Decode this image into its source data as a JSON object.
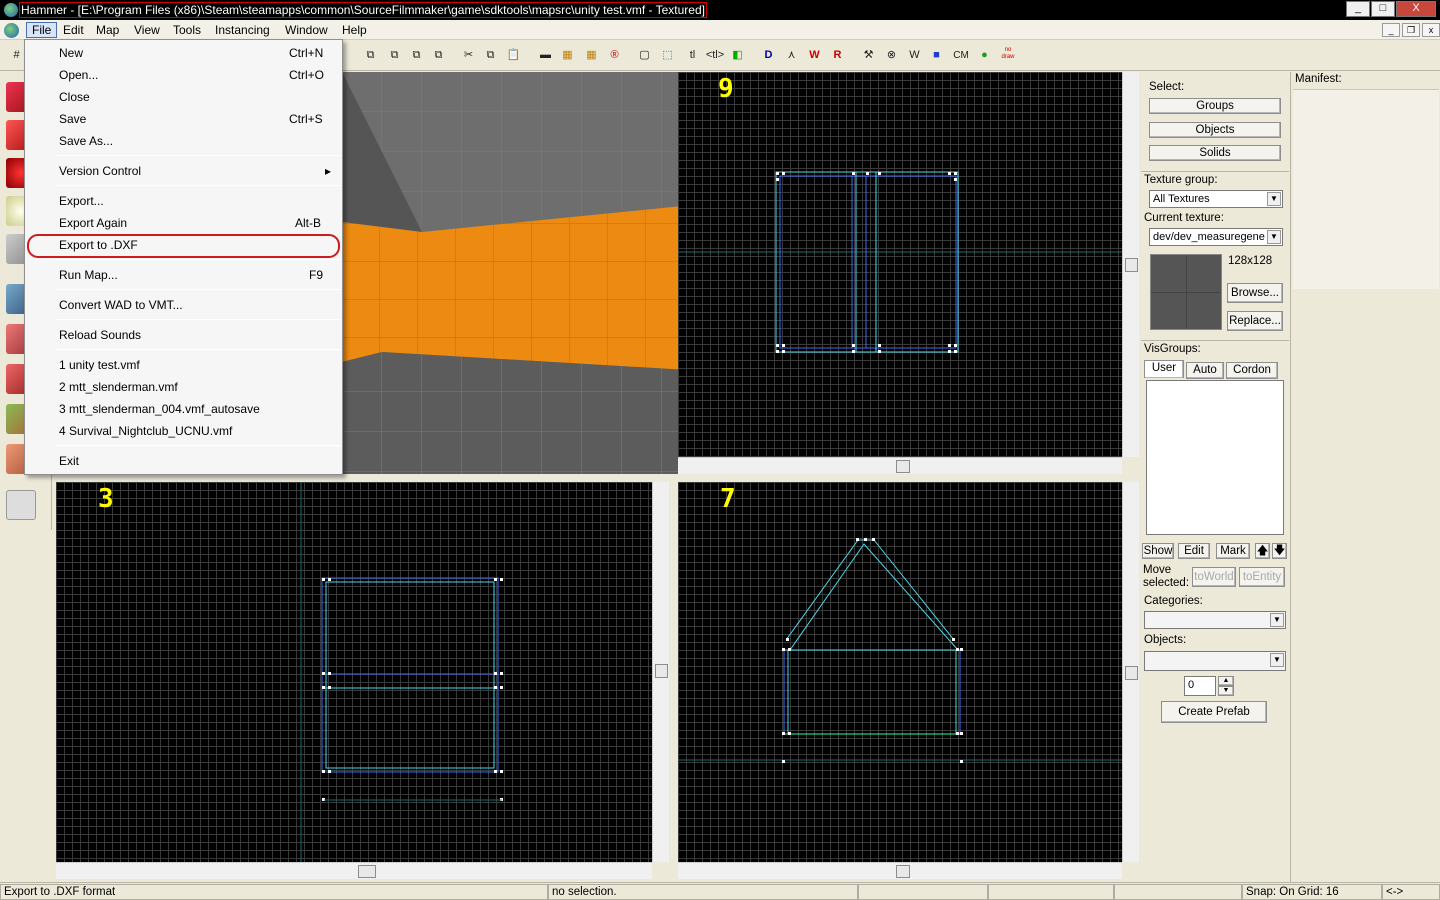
{
  "window": {
    "title": "Hammer - [E:\\Program Files (x86)\\Steam\\steamapps\\common\\SourceFilmmaker\\game\\sdktools\\mapsrc\\unity test.vmf - Textured]",
    "buttons": {
      "minimize": "_",
      "maximize": "□",
      "close": "X"
    },
    "mdi_buttons": {
      "minimize": "_",
      "restore": "❐",
      "close": "x"
    }
  },
  "menubar": [
    "File",
    "Edit",
    "Map",
    "View",
    "Tools",
    "Instancing",
    "Window",
    "Help"
  ],
  "file_menu": {
    "items": [
      {
        "label": "New",
        "shortcut": "Ctrl+N"
      },
      {
        "label": "Open...",
        "shortcut": "Ctrl+O"
      },
      {
        "label": "Close",
        "shortcut": ""
      },
      {
        "label": "Save",
        "shortcut": "Ctrl+S"
      },
      {
        "label": "Save As...",
        "shortcut": ""
      },
      {
        "label": "Version Control",
        "shortcut": "▸"
      },
      {
        "label": "Export...",
        "shortcut": ""
      },
      {
        "label": "Export Again",
        "shortcut": "Alt-B"
      },
      {
        "label": "Export to .DXF",
        "shortcut": ""
      },
      {
        "label": "Run Map...",
        "shortcut": "F9"
      },
      {
        "label": "Convert WAD to VMT...",
        "shortcut": ""
      },
      {
        "label": "Reload Sounds",
        "shortcut": ""
      },
      {
        "label": "1 unity test.vmf",
        "shortcut": ""
      },
      {
        "label": "2 mtt_slenderman.vmf",
        "shortcut": ""
      },
      {
        "label": "3 mtt_slenderman_004.vmf_autosave",
        "shortcut": ""
      },
      {
        "label": "4 Survival_Nightclub_UCNU.vmf",
        "shortcut": ""
      },
      {
        "label": "Exit",
        "shortcut": ""
      }
    ]
  },
  "toolbar": {
    "buttons": [
      "✂",
      "⧉",
      "📋",
      "▬",
      "▦",
      "▦",
      "®",
      "▢",
      "⬚",
      "tl",
      "<tl>",
      "◧",
      "D",
      "⋏",
      "W",
      "R",
      "⚒",
      "⊗",
      "W",
      "■",
      "CM",
      "●",
      "no draw"
    ]
  },
  "viewports": {
    "top_right_label": "9",
    "bottom_left_label": "3",
    "bottom_right_label": "7"
  },
  "right_panel": {
    "select_label": "Select:",
    "groups": "Groups",
    "objects": "Objects",
    "solids": "Solids",
    "texture_group_label": "Texture group:",
    "texture_group_value": "All Textures",
    "current_texture_label": "Current texture:",
    "current_texture_value": "dev/dev_measuregene",
    "texture_size": "128x128",
    "browse": "Browse...",
    "replace": "Replace...",
    "visgroups_label": "VisGroups:",
    "tab_user": "User",
    "tab_auto": "Auto",
    "tab_cordon": "Cordon",
    "show": "Show",
    "edit": "Edit",
    "mark": "Mark",
    "up": "🡅",
    "down": "🡇",
    "move_selected_label": "Move selected:",
    "to_world": "toWorld",
    "to_entity": "toEntity",
    "categories_label": "Categories:",
    "objects_label": "Objects:",
    "count_value": "0",
    "create_prefab": "Create Prefab"
  },
  "manifest": {
    "label": "Manifest:"
  },
  "statusbar": {
    "left": "Export to .DXF format",
    "selection": "no selection.",
    "snap": "Snap: On Grid: 16",
    "arrows": "<->"
  },
  "colors": {
    "highlight_outline": "#cc1c1c",
    "viewport_label": "#ffff00",
    "brush_blue": "#3a6cff",
    "brush_cyan": "#44ddee",
    "orange_wall": "#e88a10"
  }
}
